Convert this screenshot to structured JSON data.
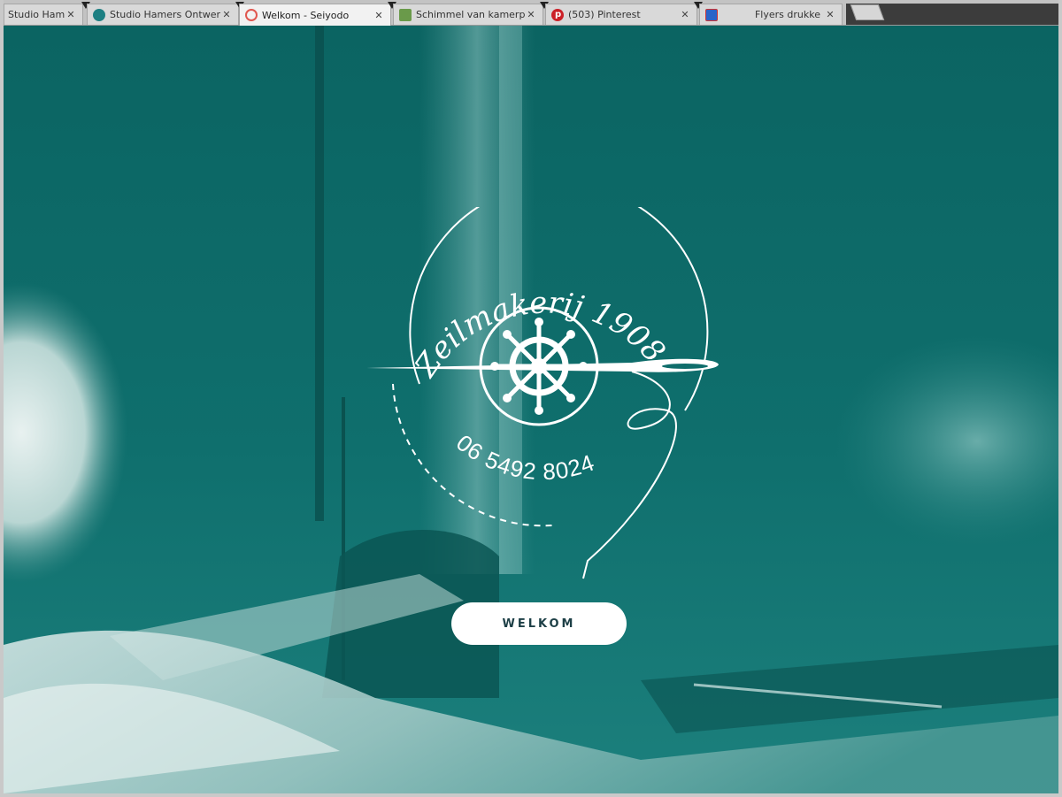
{
  "browser": {
    "tabs": [
      {
        "title": "Studio Ham",
        "favicon": "none",
        "active": false
      },
      {
        "title": "Studio Hamers Ontwerp",
        "favicon": "teal-circle",
        "active": false
      },
      {
        "title": "Welkom - Seiyodo",
        "favicon": "red-ring",
        "active": true
      },
      {
        "title": "Schimmel van kamerpla",
        "favicon": "green-square",
        "active": false
      },
      {
        "title": "(503) Pinterest",
        "favicon": "pinterest",
        "active": false
      },
      {
        "title": "",
        "favicon": "blue-square",
        "active": false
      },
      {
        "title": "Flyers drukke",
        "favicon": "none",
        "active": false
      }
    ],
    "close_glyph": "✕"
  },
  "hero": {
    "logo_text_top": "Zeilmakerij 1908",
    "logo_text_bottom": "06 5492 8024",
    "logo_icon": "ship-wheel-icon",
    "button_label": "WELKOM"
  },
  "colors": {
    "teal": "#0f6d6b",
    "teal_dark": "#0a5553",
    "teal_light": "#5fa6a3",
    "white": "#ffffff",
    "button_text": "#1d3f46"
  }
}
